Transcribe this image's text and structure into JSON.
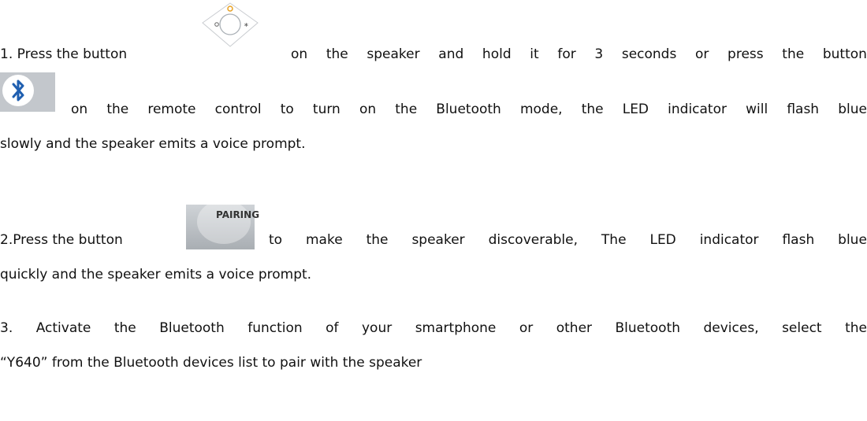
{
  "step1": {
    "prefix": "1. Press the button",
    "after_icon": "on the speaker and hold it for 3 seconds or press the button",
    "line2": "on the remote control to turn on the Bluetooth mode, the LED indicator will flash blue",
    "line3": "slowly and the speaker emits a voice prompt.",
    "speaker_button_icon": "speaker-mode-button-icon",
    "remote_button_icon": "bluetooth-remote-button-icon"
  },
  "step2": {
    "prefix": "2.Press the button",
    "icon_label": "PAIRING",
    "after_icon": "to make the speaker discoverable, The LED indicator flash blue",
    "line2": "quickly and the speaker emits a voice prompt.",
    "pairing_icon": "pairing-button-icon"
  },
  "step3": {
    "line1": "3. Activate the Bluetooth function of your smartphone or other Bluetooth devices, select the",
    "line2": "“Y640” from the Bluetooth devices list to pair with the speaker"
  },
  "colors": {
    "text": "#111111",
    "bluetooth_blue": "#1f5fb0",
    "icon_grey": "#bfc3c8"
  }
}
